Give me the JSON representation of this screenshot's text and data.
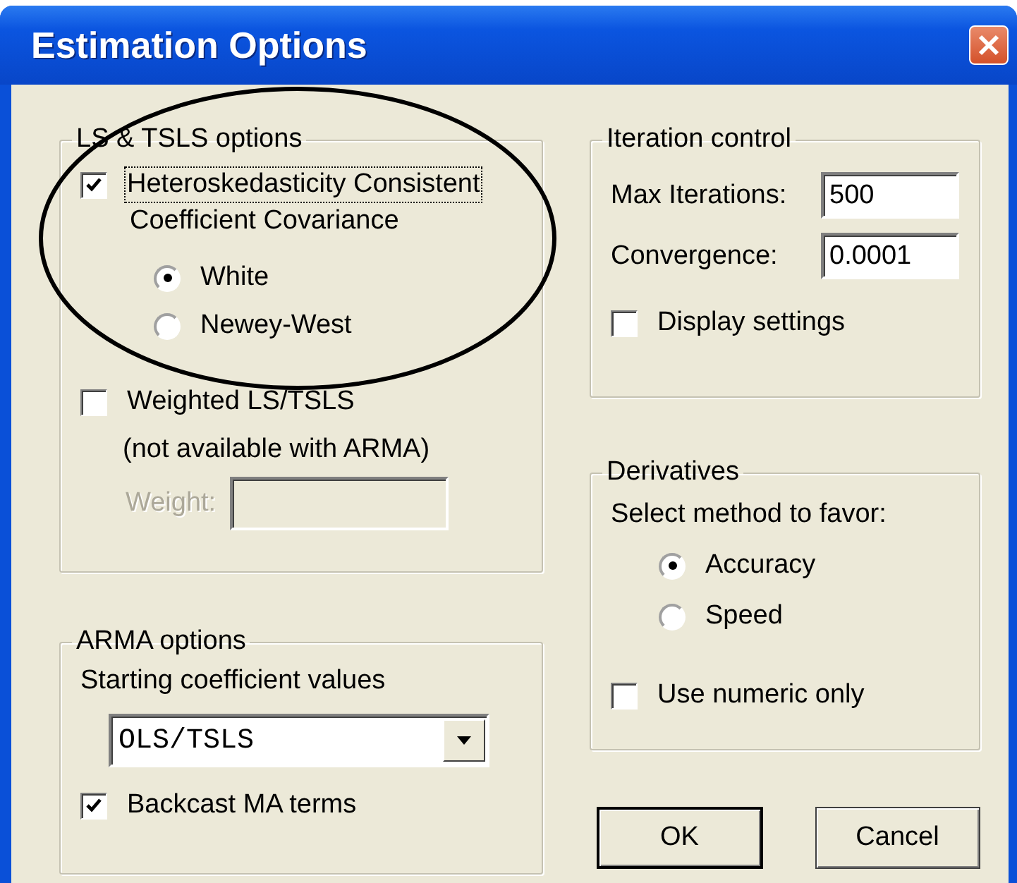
{
  "window": {
    "title": "Estimation Options"
  },
  "ls_tsls_group": {
    "title": "LS & TSLS options",
    "hac_checkbox": {
      "label": "Heteroskedasticity Consistent",
      "label_line_2": "Coefficient Covariance",
      "checked": true,
      "focused": true
    },
    "covariance_methods": [
      {
        "label": "White",
        "selected": true
      },
      {
        "label": "Newey-West",
        "selected": false
      }
    ],
    "weighted_checkbox": {
      "label": "Weighted LS/TSLS",
      "checked": false
    },
    "weighted_note": "(not available with ARMA)",
    "weight_field": {
      "label": "Weight:",
      "disabled": true
    }
  },
  "arma_group": {
    "title": "ARMA options",
    "starting_label": "Starting coefficient values",
    "starting_select": {
      "value": "OLS/TSLS"
    },
    "backcast_checkbox": {
      "label": "Backcast MA terms",
      "checked": true
    }
  },
  "iteration_group": {
    "title": "Iteration control",
    "fields": [
      {
        "label": "Max Iterations:",
        "value": "500"
      },
      {
        "label": "Convergence:",
        "value": "0.0001"
      }
    ],
    "display_checkbox": {
      "label": "Display settings",
      "checked": false
    }
  },
  "derivatives_group": {
    "title": "Derivatives",
    "prompt": "Select method to favor:",
    "methods": [
      {
        "label": "Accuracy",
        "selected": true
      },
      {
        "label": "Speed",
        "selected": false
      }
    ],
    "numeric_checkbox": {
      "label": "Use numeric only",
      "checked": false
    }
  },
  "buttons": [
    {
      "label": "OK",
      "default": true
    },
    {
      "label": "Cancel",
      "default": false
    }
  ]
}
